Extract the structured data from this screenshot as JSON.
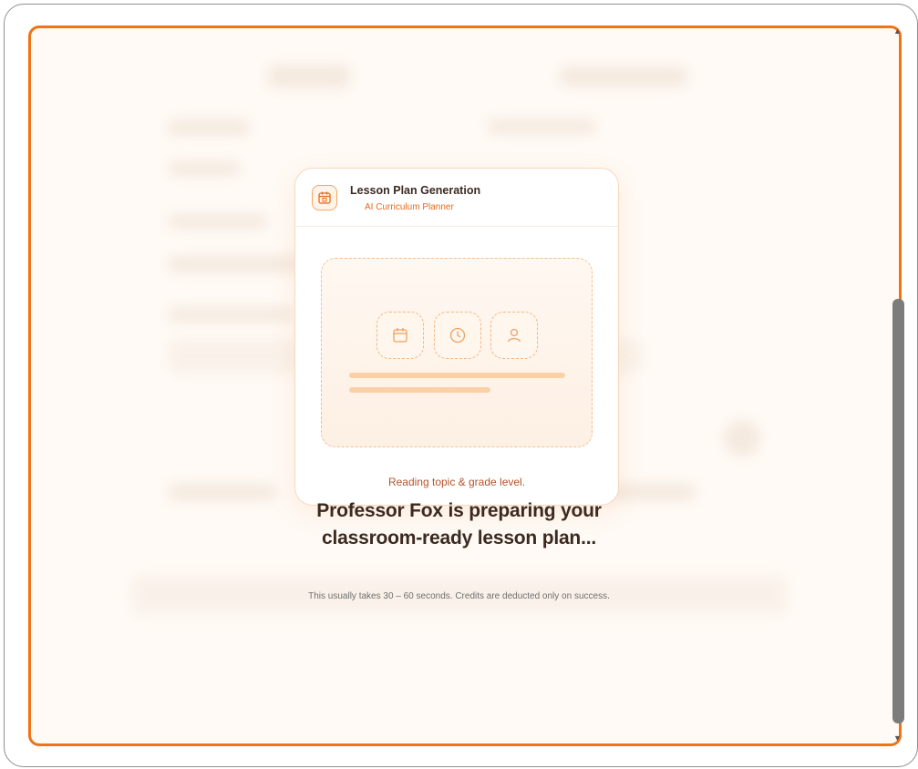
{
  "card": {
    "title": "Lesson Plan Generation",
    "subtitle": "AI Curriculum Planner",
    "status": "Reading topic & grade level."
  },
  "loading": {
    "heading_line1": "Professor Fox is preparing your",
    "heading_line2": "classroom-ready lesson plan...",
    "note": "This usually takes 30 – 60 seconds. Credits are deducted only on success."
  },
  "icons": {
    "header": "calendar-icon",
    "tiles": [
      "calendar-icon",
      "clock-icon",
      "user-icon"
    ]
  },
  "colors": {
    "accent": "#f07314",
    "title": "#3c2a20",
    "status": "#b5532b"
  }
}
